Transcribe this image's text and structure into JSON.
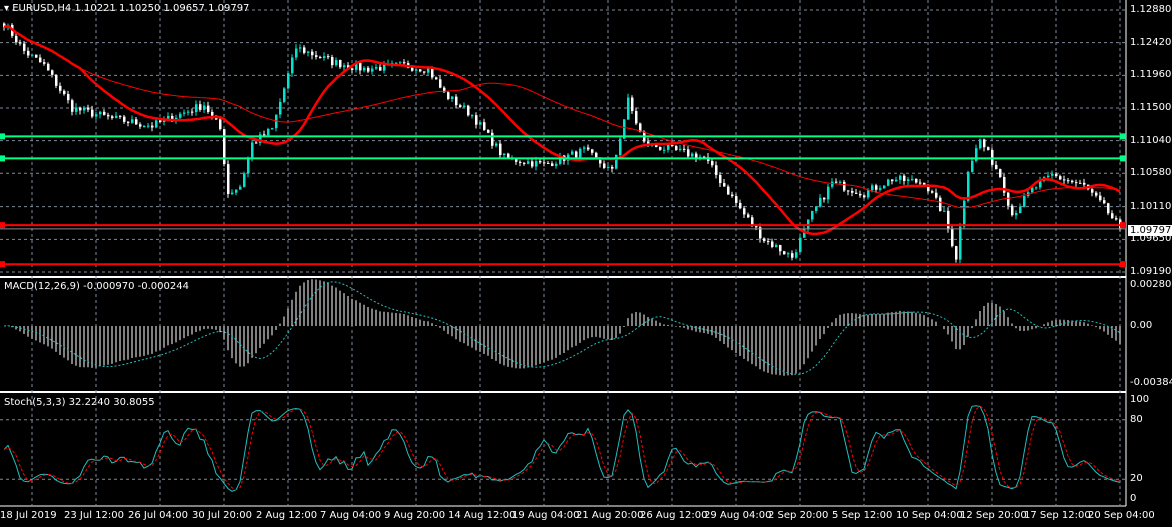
{
  "header": {
    "symbol": "EURUSD,H4",
    "open": "1.10221",
    "high": "1.10250",
    "low": "1.09657",
    "close": "1.09797"
  },
  "macd": {
    "title": "MACD(12,26,9)",
    "main": "-0.000970",
    "signal": "-0.000244",
    "axis": [
      "0.002805",
      "0.00",
      "-0.003845"
    ]
  },
  "stoch": {
    "title": "Stoch(5,3,3)",
    "k": "32.2240",
    "d": "30.8055",
    "axis": [
      "100",
      "80",
      "20",
      "0"
    ]
  },
  "price_axis": [
    "1.12880",
    "1.12420",
    "1.11960",
    "1.11500",
    "1.11040",
    "1.10580",
    "1.10110",
    "1.09650",
    "1.09190"
  ],
  "current_price": "1.09797",
  "colors": {
    "bull": "#00e5d0",
    "bear": "#ffffff",
    "ma": "#ff0000",
    "support": "#00ff88",
    "signal": "#20c0c0",
    "stoch_d": "#ff0000",
    "grid": "#7f8a99"
  },
  "chart_data": {
    "type": "candlestick",
    "price_range": [
      1.0919,
      1.1288
    ],
    "horizontal_levels": {
      "green": [
        1.111,
        1.1079
      ],
      "red": [
        1.0985,
        1.093
      ]
    },
    "waypoints_bar_price": [
      [
        0,
        1.127
      ],
      [
        5,
        1.123
      ],
      [
        10,
        1.121
      ],
      [
        17,
        1.115
      ],
      [
        27,
        1.1135
      ],
      [
        37,
        1.1125
      ],
      [
        50,
        1.1155
      ],
      [
        54,
        1.112
      ],
      [
        56,
        1.103
      ],
      [
        59,
        1.104
      ],
      [
        62,
        1.11
      ],
      [
        67,
        1.112
      ],
      [
        73,
        1.1235
      ],
      [
        82,
        1.1215
      ],
      [
        90,
        1.1205
      ],
      [
        100,
        1.121
      ],
      [
        106,
        1.1205
      ],
      [
        110,
        1.117
      ],
      [
        117,
        1.114
      ],
      [
        125,
        1.108
      ],
      [
        135,
        1.107
      ],
      [
        145,
        1.109
      ],
      [
        152,
        1.106
      ],
      [
        156,
        1.116
      ],
      [
        160,
        1.11
      ],
      [
        175,
        1.108
      ],
      [
        185,
        1.1
      ],
      [
        190,
        1.0965
      ],
      [
        197,
        1.094
      ],
      [
        202,
        1.1
      ],
      [
        207,
        1.1045
      ],
      [
        215,
        1.103
      ],
      [
        222,
        1.105
      ],
      [
        230,
        1.1045
      ],
      [
        235,
        1.1
      ],
      [
        238,
        1.094
      ],
      [
        241,
        1.1065
      ],
      [
        244,
        1.1105
      ],
      [
        249,
        1.1055
      ],
      [
        252,
        1.1
      ],
      [
        257,
        1.1035
      ],
      [
        262,
        1.1055
      ],
      [
        270,
        1.104
      ],
      [
        275,
        1.101
      ],
      [
        279,
        1.098
      ]
    ],
    "time_labels": [
      "18 Jul 2019",
      "23 Jul 12:00",
      "26 Jul 04:00",
      "30 Jul 20:00",
      "2 Aug 12:00",
      "7 Aug 04:00",
      "9 Aug 20:00",
      "14 Aug 12:00",
      "19 Aug 04:00",
      "21 Aug 20:00",
      "26 Aug 12:00",
      "29 Aug 04:00",
      "2 Sep 20:00",
      "5 Sep 12:00",
      "10 Sep 04:00",
      "12 Sep 20:00",
      "17 Sep 12:00",
      "20 Sep 04:00"
    ]
  }
}
